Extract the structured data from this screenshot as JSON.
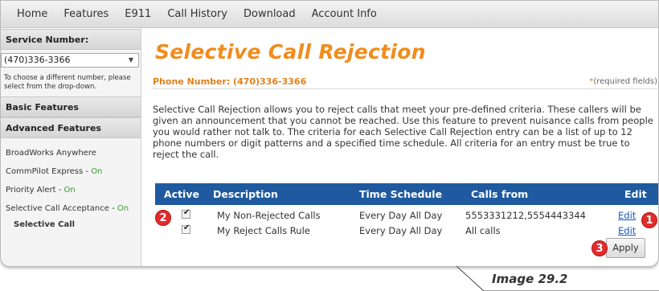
{
  "nav": {
    "items": [
      "Home",
      "Features",
      "E911",
      "Call History",
      "Download",
      "Account Info"
    ]
  },
  "sidebar": {
    "service_number_heading": "Service Number:",
    "selected_number": "(470)336-3366",
    "help_text": "To choose a different number, please select from the drop-down.",
    "basic_features": "Basic Features",
    "advanced_features": "Advanced Features",
    "links": [
      {
        "label": "BroadWorks Anywhere",
        "status": ""
      },
      {
        "label": "CommPilot Express - ",
        "status": "On"
      },
      {
        "label": "Priority Alert - ",
        "status": "On"
      },
      {
        "label": "Selective Call Acceptance - ",
        "status": "On"
      },
      {
        "label": "Selective Call",
        "status": ""
      }
    ]
  },
  "main": {
    "title": "Selective Call Rejection",
    "phone_label": "Phone Number: (470)336-3366",
    "required_star": "*",
    "required_text": "(required fields)",
    "description": "Selective Call Rejection allows you to reject calls that meet your pre-defined criteria. These callers will be given an announcement that you cannot be reached. Use this feature to prevent nuisance calls from people you would rather not talk to. The criteria for each Selective Call Rejection entry can be a list of up to 12 phone numbers or digit patterns and a specified time schedule. All criteria for an entry must be true to reject the call.",
    "columns": [
      "Active",
      "Description",
      "Time Schedule",
      "Calls from",
      "Edit"
    ],
    "rows": [
      {
        "active": true,
        "description": "My Non-Rejected Calls",
        "schedule": "Every Day All Day",
        "calls_from": "5553331212,5554443344",
        "edit": "Edit"
      },
      {
        "active": true,
        "description": "My Reject Calls Rule",
        "schedule": "Every Day All Day",
        "calls_from": "All calls",
        "edit": "Edit"
      }
    ],
    "apply_label": "Apply"
  },
  "badges": [
    "1",
    "2",
    "3"
  ],
  "caption": "Image 29.2",
  "colors": {
    "accent_orange": "#f08c1d",
    "table_header": "#1f5aa0",
    "badge_red": "#e22b2b",
    "on_green": "#3a9a2f",
    "link_blue": "#1a57b5"
  },
  "icons": {
    "dropdown": "chevron-down-icon",
    "checkbox": "checkmark-icon"
  }
}
